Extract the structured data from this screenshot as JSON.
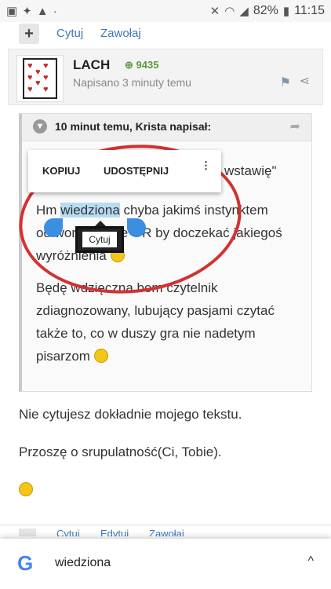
{
  "statusbar": {
    "battery": "82%",
    "time": "11:15",
    "icons_left": [
      "image-icon",
      "twitter-icon",
      "warning-icon",
      "dot-icon"
    ],
    "icons_right": [
      "mute-icon",
      "wifi-icon",
      "signal-icon",
      "battery-icon"
    ]
  },
  "topactions": {
    "plus": "+",
    "quote": "Cytuj",
    "mention": "Zawołaj"
  },
  "post": {
    "author": "LACH",
    "reputation": "9435",
    "posted": "Napisano 3 minuty temu"
  },
  "quote": {
    "header": "10 minut temu, Krista napisał:",
    "partial_line": "wstawię\"",
    "para1": {
      "before": "Hm ",
      "highlight": "wiedziona",
      "after": " chyba jakimś instynktem odtworzę swoje OR by doczekać jakiegoś wyróżnienia"
    },
    "para2": "Będę wdzięczna bom czytelnik zdiagnozowany, lubujący pasjami czytać także to, co w duszy gra nie nadetym pisarzom"
  },
  "selection_menu": {
    "copy": "KOPIUJ",
    "share": "UDOSTĘPNIJ",
    "more": "⋮",
    "tooltip": "Cytuj"
  },
  "reply": {
    "line1": "Nie cytujesz dokładnie mojego tekstu.",
    "line2": "Przoszę o srupulatność(Ci, Tobie)."
  },
  "bottom_actions": {
    "quote": "Cytuj",
    "edit": "Edytuj",
    "mention": "Zawołaj"
  },
  "google_bar": {
    "logo": "G",
    "term": "wiedziona",
    "chevron": "^"
  },
  "colors": {
    "link": "#3d78b8",
    "circle": "#d43131",
    "highlight": "#b6dcf3",
    "handle": "#3b8ee0",
    "reputation": "#5a9a40"
  }
}
